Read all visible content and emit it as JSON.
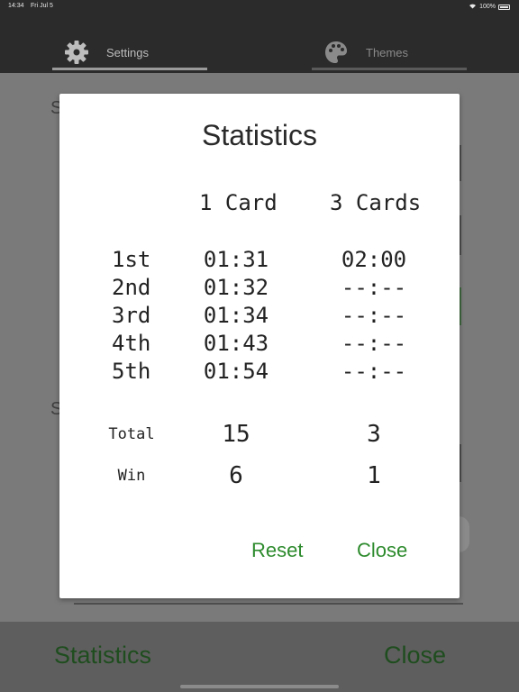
{
  "statusbar": {
    "time": "14:34",
    "date": "Fri Jul 5",
    "battery": "100%"
  },
  "tabs": [
    {
      "label": "Settings",
      "icon": "gear-icon"
    },
    {
      "label": "Themes",
      "icon": "palette-icon"
    }
  ],
  "background": {
    "letter_top": "S",
    "letter_mid": "S"
  },
  "dialog": {
    "title": "Statistics",
    "columns": [
      "1 Card",
      "3 Cards"
    ],
    "rows": [
      {
        "rank": "1st",
        "one": "01:31",
        "three": "02:00"
      },
      {
        "rank": "2nd",
        "one": "01:32",
        "three": "--:--"
      },
      {
        "rank": "3rd",
        "one": "01:34",
        "three": "--:--"
      },
      {
        "rank": "4th",
        "one": "01:43",
        "three": "--:--"
      },
      {
        "rank": "5th",
        "one": "01:54",
        "three": "--:--"
      }
    ],
    "total": {
      "label": "Total",
      "one": "15",
      "three": "3"
    },
    "win": {
      "label": "Win",
      "one": "6",
      "three": "1"
    },
    "reset_label": "Reset",
    "close_label": "Close"
  },
  "bottombar": {
    "statistics_label": "Statistics",
    "close_label": "Close"
  },
  "colors": {
    "accent_green": "#2e8b2e",
    "bottom_green": "#1f4d1f",
    "dark_bar": "#2b2b2b"
  }
}
